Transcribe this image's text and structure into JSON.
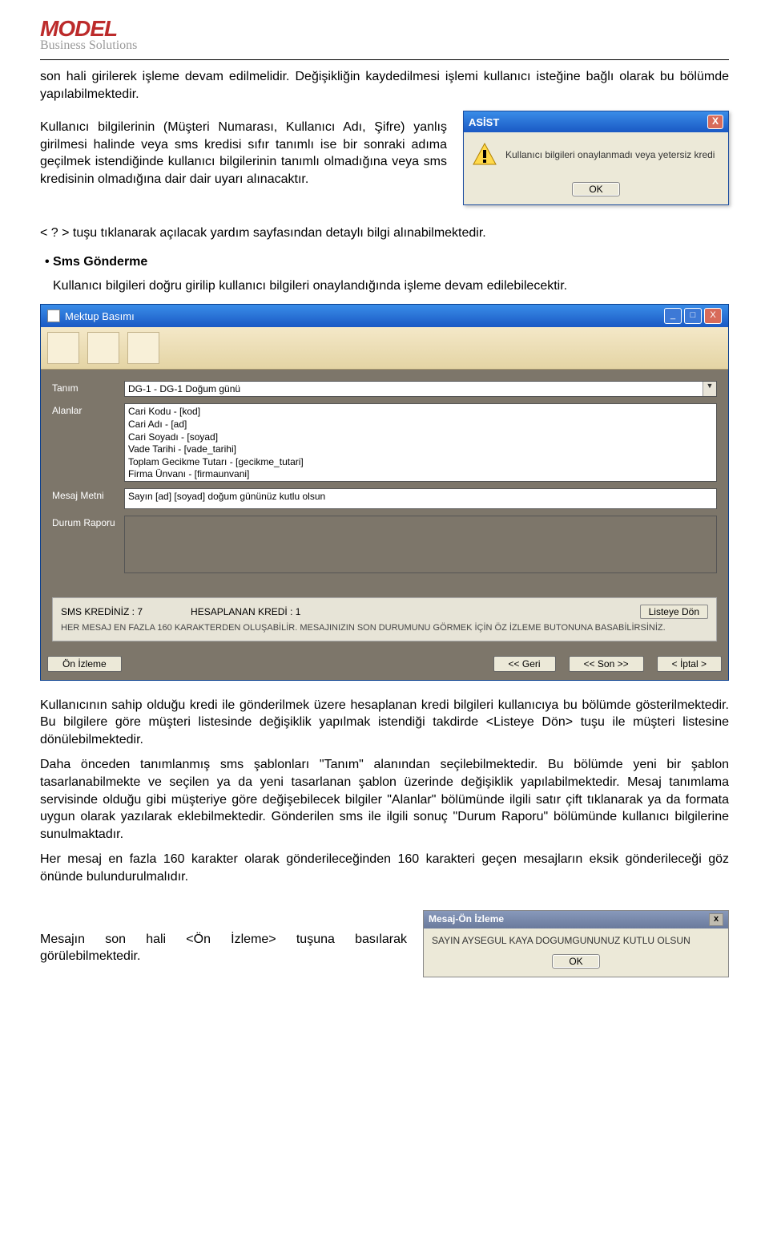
{
  "logo": {
    "name": "MODEL",
    "sub": "Business Solutions"
  },
  "para1": "son hali girilerek işleme devam edilmelidir. Değişikliğin kaydedilmesi işlemi kullanıcı isteğine bağlı olarak bu bölümde yapılabilmektedir.",
  "para2": "Kullanıcı bilgilerinin (Müşteri Numarası, Kullanıcı Adı, Şifre) yanlış girilmesi halinde veya sms kredisi sıfır tanımlı ise bir sonraki adıma geçilmek istendiğinde kullanıcı bilgilerinin tanımlı olmadığına veya sms kredisinin olmadığına dair dair uyarı alınacaktır.",
  "asist": {
    "title": "ASİST",
    "msg": "Kullanıcı bilgileri onaylanmadı veya yetersiz kredi",
    "ok": "OK"
  },
  "para3": "< ? > tuşu tıklanarak açılacak yardım sayfasından detaylı bilgi alınabilmektedir.",
  "sms_head": "Sms Gönderme",
  "para4": "Kullanıcı bilgileri doğru girilip kullanıcı bilgileri onaylandığında işleme devam edilebilecektir.",
  "mektup": {
    "title": "Mektup Basımı",
    "labels": {
      "tanim": "Tanım",
      "alanlar": "Alanlar",
      "mesaj": "Mesaj Metni",
      "durum": "Durum Raporu"
    },
    "tanim_value": "DG-1 - DG-1  Doğum günü",
    "alanlar_list": [
      "Cari Kodu - [kod]",
      "Cari Adı - [ad]",
      "Cari Soyadı - [soyad]",
      "Vade Tarihi - [vade_tarihi]",
      "Toplam Gecikme Tutarı - [gecikme_tutari]",
      "Firma Ünvanı - [firmaunvani]"
    ],
    "mesaj_value": "Sayın [ad] [soyad] doğum gününüz kutlu olsun",
    "kredi_label": "SMS KREDİNİZ : 7",
    "hesap_label": "HESAPLANAN KREDİ : 1",
    "liste_don": "Listeye Dön",
    "note": "HER MESAJ EN FAZLA 160 KARAKTERDEN OLUŞABİLİR. MESAJINIZIN SON DURUMUNU GÖRMEK İÇİN ÖZ İZLEME BUTONUNA BASABİLİRSİNİZ.",
    "btn_onizleme": "Ön İzleme",
    "btn_geri": "<<  Geri",
    "btn_son": "<<  Son >>",
    "btn_iptal": "<  İptal >"
  },
  "para5": "Kullanıcının sahip olduğu kredi ile gönderilmek üzere hesaplanan kredi bilgileri kullanıcıya bu bölümde gösterilmektedir. Bu bilgilere göre müşteri listesinde değişiklik yapılmak istendiği takdirde <Listeye Dön> tuşu ile müşteri listesine dönülebilmektedir.",
  "para6": "Daha önceden tanımlanmış sms şablonları \"Tanım\" alanından seçilebilmektedir. Bu bölümde yeni bir şablon tasarlanabilmekte ve seçilen ya da yeni tasarlanan şablon üzerinde değişiklik yapılabilmektedir. Mesaj tanımlama servisinde olduğu gibi müşteriye göre değişebilecek bilgiler \"Alanlar\" bölümünde ilgili satır çift tıklanarak ya da formata uygun olarak yazılarak eklebilmektedir. Gönderilen sms ile ilgili sonuç \"Durum Raporu\" bölümünde kullanıcı bilgilerine sunulmaktadır.",
  "para7": "Her mesaj en fazla 160 karakter olarak gönderileceğinden 160 karakteri geçen mesajların eksik gönderileceği göz önünde bulundurulmalıdır.",
  "para8": "Mesajın son hali <Ön İzleme> tuşuna basılarak görülebilmektedir.",
  "onizleme": {
    "title": "Mesaj-Ön İzleme",
    "body": "SAYIN AYSEGUL KAYA DOGUMGUNUNUZ KUTLU OLSUN",
    "ok": "OK"
  }
}
